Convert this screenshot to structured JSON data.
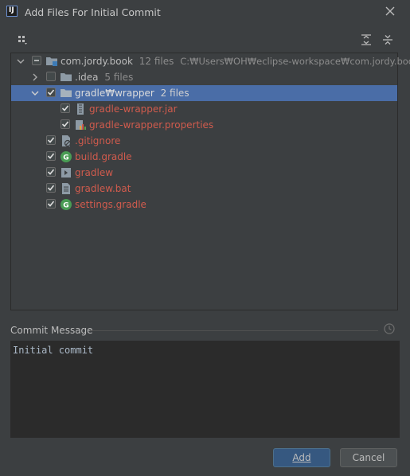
{
  "window": {
    "title": "Add Files For Initial Commit",
    "app_icon_letter": "IJ"
  },
  "tree": {
    "root": {
      "name": "com.jordy.book",
      "count": "12 files",
      "path": "C:₩Users₩OH₩eclipse-workspace₩com.jordy.book"
    },
    "items": [
      {
        "name": ".idea",
        "count": "5 files"
      },
      {
        "name": "gradle₩wrapper",
        "count": "2 files"
      },
      {
        "name": "gradle-wrapper.jar"
      },
      {
        "name": "gradle-wrapper.properties"
      },
      {
        "name": ".gitignore"
      },
      {
        "name": "build.gradle"
      },
      {
        "name": "gradlew"
      },
      {
        "name": "gradlew.bat"
      },
      {
        "name": "settings.gradle"
      }
    ]
  },
  "commit": {
    "label": "Commit Message",
    "value": "Initial commit"
  },
  "buttons": {
    "add": "Add",
    "cancel": "Cancel"
  },
  "colors": {
    "selection": "#4a6da7",
    "unversioned_file": "#d05b4d",
    "primary_button": "#365880"
  }
}
